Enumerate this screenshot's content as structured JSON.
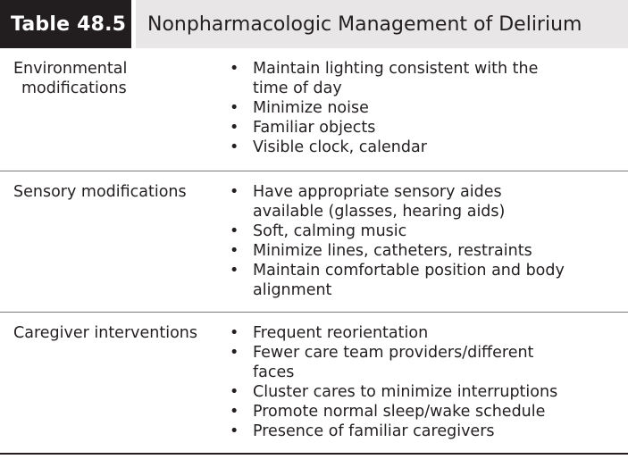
{
  "table": {
    "number": "Table 48.5",
    "title": "Nonpharmacologic Management of Delirium"
  },
  "rows": [
    {
      "label_line1": "Environmental",
      "label_line2": "modifications",
      "items": [
        [
          "Maintain lighting consistent with the",
          "time of day"
        ],
        [
          "Minimize noise"
        ],
        [
          "Familiar objects"
        ],
        [
          "Visible clock, calendar"
        ]
      ]
    },
    {
      "label_line1": "Sensory modifications",
      "items": [
        [
          "Have appropriate sensory aides",
          "available (glasses, hearing aids)"
        ],
        [
          "Soft, calming music"
        ],
        [
          "Minimize lines, catheters, restraints"
        ],
        [
          "Maintain comfortable position and body",
          "alignment"
        ]
      ]
    },
    {
      "label_line1": "Caregiver interventions",
      "items": [
        [
          "Frequent reorientation"
        ],
        [
          "Fewer care team providers/different",
          "faces"
        ],
        [
          "Cluster cares to minimize interruptions"
        ],
        [
          "Promote normal sleep/wake schedule"
        ],
        [
          "Presence of familiar caregivers"
        ]
      ]
    }
  ],
  "bullet_glyph": "•"
}
